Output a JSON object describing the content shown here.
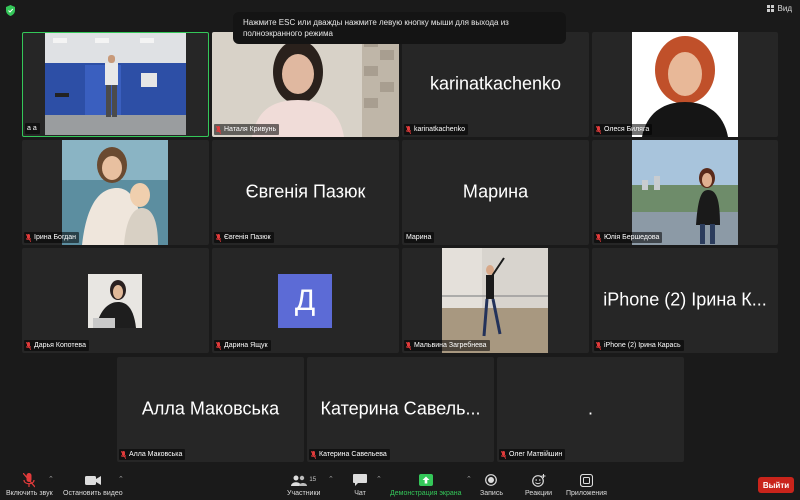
{
  "topbar": {
    "view_label": "Вид"
  },
  "toast": {
    "message": "Нажмите ESC или дважды нажмите левую кнопку мыши для выхода из полноэкранного режима"
  },
  "colors": {
    "active_speaker": "#34c759",
    "leave": "#c9241b",
    "avatar": "#5c6bd6",
    "share_screen": "#34c759"
  },
  "participants": [
    {
      "label": "a a",
      "muted": false,
      "video": true
    },
    {
      "label": "Наталя Кривунь",
      "muted": true,
      "video": true
    },
    {
      "label": "karinatkachenko",
      "muted": true,
      "video": false,
      "display_name": "karinatkachenko"
    },
    {
      "label": "Олеся Биляга",
      "muted": true,
      "video": true
    },
    {
      "label": "Ірина Богдан",
      "muted": true,
      "video": true
    },
    {
      "label": "Євгенія Пазюк",
      "muted": true,
      "video": false,
      "display_name": "Євгенія Пазюк"
    },
    {
      "label": "Марина",
      "muted": false,
      "video": false,
      "display_name": "Марина"
    },
    {
      "label": "Юлія Бершедова",
      "muted": true,
      "video": true
    },
    {
      "label": "Дарья Копотева",
      "muted": true,
      "video": true
    },
    {
      "label": "Дарина Ящук",
      "muted": true,
      "video": false,
      "avatar_letter": "Д"
    },
    {
      "label": "Мальвина Загребнева",
      "muted": true,
      "video": true
    },
    {
      "label": "iPhone (2) Ірина Карась",
      "muted": true,
      "video": false,
      "display_name": "iPhone (2) Ірина К..."
    },
    {
      "label": "Алла Маковська",
      "muted": true,
      "video": false,
      "display_name": "Алла Маковська"
    },
    {
      "label": "Катерина Савельева",
      "muted": true,
      "video": false,
      "display_name": "Катерина Савель..."
    },
    {
      "label": "Олег Матвійшин",
      "muted": true,
      "video": false,
      "display_name": "."
    }
  ],
  "toolbar": {
    "unmute": "Включить звук",
    "stop_video": "Остановить видео",
    "participants": "Участники",
    "participants_count": "15",
    "chat": "Чат",
    "share_screen": "Демонстрация экрана",
    "record": "Запись",
    "reactions": "Реакции",
    "apps": "Приложения",
    "leave": "Выйти"
  }
}
